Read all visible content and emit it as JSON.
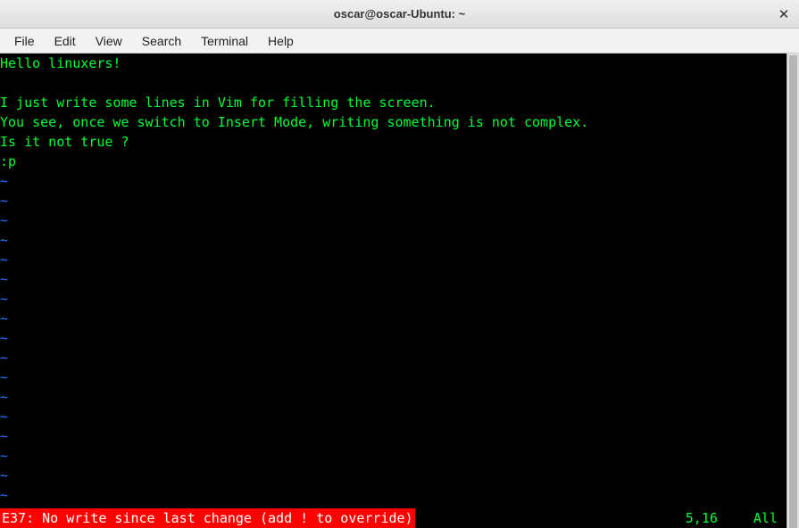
{
  "window": {
    "title": "oscar@oscar-Ubuntu: ~",
    "close_glyph": "✕"
  },
  "menu": {
    "items": [
      "File",
      "Edit",
      "View",
      "Search",
      "Terminal",
      "Help"
    ]
  },
  "terminal": {
    "lines": [
      "Hello linuxers!",
      "",
      "I just write some lines in Vim for filling the screen.",
      "You see, once we switch to Insert Mode, writing something is not complex.",
      "Is it not true ?",
      ":p"
    ],
    "tilde": "~",
    "tilde_count": 17
  },
  "status": {
    "error": "E37: No write since last change (add ! to override)",
    "position": "5,16",
    "scroll": "All"
  }
}
